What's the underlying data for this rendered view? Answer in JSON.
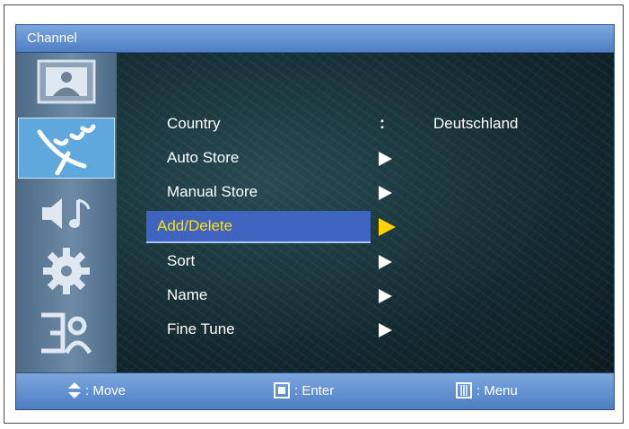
{
  "window": {
    "title": "Channel"
  },
  "sidebar": {
    "items": [
      {
        "icon": "picture-icon",
        "active": false
      },
      {
        "icon": "antenna-icon",
        "active": true
      },
      {
        "icon": "sound-icon",
        "active": false
      },
      {
        "icon": "gear-icon",
        "active": false
      },
      {
        "icon": "input-icon",
        "active": false
      }
    ]
  },
  "menu": {
    "items": [
      {
        "label": "Country",
        "indicator": ":",
        "value": "Deutschland"
      },
      {
        "label": "Auto Store",
        "indicator": "arrow"
      },
      {
        "label": "Manual Store",
        "indicator": "arrow"
      },
      {
        "label": "Add/Delete",
        "indicator": "arrow",
        "selected": true
      },
      {
        "label": "Sort",
        "indicator": "arrow"
      },
      {
        "label": "Name",
        "indicator": "arrow"
      },
      {
        "label": "Fine Tune",
        "indicator": "arrow"
      }
    ]
  },
  "footer": {
    "move_label": ": Move",
    "enter_label": ": Enter",
    "menu_label": ": Menu"
  },
  "colors": {
    "titlebar": "#5f8fcf",
    "selection": "#3f64bf",
    "selected_text": "#ffe000",
    "active_icon_bg": "#5ea8de"
  }
}
